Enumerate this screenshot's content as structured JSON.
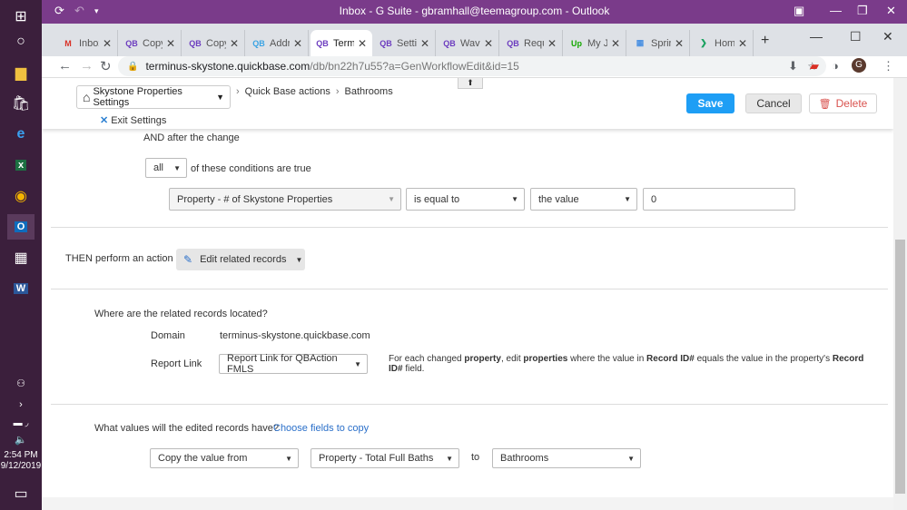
{
  "window": {
    "title": "Inbox - G Suite - gbramhall@teemagroup.com - Outlook"
  },
  "taskbar": {
    "time": "2:54 PM",
    "date": "9/12/2019"
  },
  "tabs": [
    {
      "label": "Inbox",
      "favicon": "gmail-icon",
      "fav_text": "M",
      "fav_color": "#d93025"
    },
    {
      "label": "Copy",
      "favicon": "quickbase-icon",
      "fav_text": "QB",
      "fav_color": "#6c3cbf"
    },
    {
      "label": "Copy",
      "favicon": "quickbase-icon",
      "fav_text": "QB",
      "fav_color": "#6c3cbf"
    },
    {
      "label": "Addre",
      "favicon": "quickbase-icon",
      "fav_text": "QB",
      "fav_color": "#3aa3e3"
    },
    {
      "label": "Termi",
      "favicon": "quickbase-icon",
      "fav_text": "QB",
      "fav_color": "#6c3cbf"
    },
    {
      "label": "Settin",
      "favicon": "quickbase-icon",
      "fav_text": "QB",
      "fav_color": "#6c3cbf"
    },
    {
      "label": "Wave",
      "favicon": "quickbase-icon",
      "fav_text": "QB",
      "fav_color": "#6c3cbf"
    },
    {
      "label": "Requ",
      "favicon": "quickbase-icon",
      "fav_text": "QB",
      "fav_color": "#6c3cbf"
    },
    {
      "label": "My Jo",
      "favicon": "upwork-icon",
      "fav_text": "Up",
      "fav_color": "#14a800"
    },
    {
      "label": "Spring",
      "favicon": "grid-icon",
      "fav_text": "▦",
      "fav_color": "#4a90e2"
    },
    {
      "label": "Home",
      "favicon": "chevron-icon",
      "fav_text": "❯",
      "fav_color": "#1aa260"
    }
  ],
  "address": {
    "host": "terminus-skystone.quickbase.com",
    "path": "/db/bn22h7u55?a=GenWorkflowEdit&id=15"
  },
  "header": {
    "app_name": "Skystone Properties Settings",
    "exit_label": "Exit Settings",
    "crumbs": [
      "Quick Base actions",
      "Bathrooms"
    ],
    "save": "Save",
    "cancel": "Cancel",
    "delete": "Delete"
  },
  "condition": {
    "and_after": "AND after the change",
    "all_value": "all",
    "of_these": "of these conditions are true",
    "field": "Property - # of Skystone Properties",
    "operator": "is equal to",
    "value_type": "the value",
    "value": "0"
  },
  "action": {
    "then_label": "THEN perform an action",
    "action_value": "Edit related records"
  },
  "related": {
    "question": "Where are the related records located?",
    "domain_label": "Domain",
    "domain_value": "terminus-skystone.quickbase.com",
    "report_label": "Report Link",
    "report_value": "Report Link for QBAction FMLS",
    "note_1": "For each changed ",
    "note_property": "property",
    "note_2": ", edit ",
    "note_properties": "properties",
    "note_3": " where the value in ",
    "note_record": "Record ID#",
    "note_4": " equals the value in the property's ",
    "note_record2": "Record ID#",
    "note_5": " field."
  },
  "values": {
    "question": "What values will the edited records have?",
    "choose_link": "Choose fields to copy",
    "copy_mode": "Copy the value from",
    "source_field": "Property - Total Full Baths",
    "to_label": "to",
    "target_field": "Bathrooms"
  },
  "colors": {
    "save": "#1e9ef5",
    "delete": "#d9534f",
    "titlebar": "#7a3b8a",
    "link": "#2a6fc9"
  }
}
